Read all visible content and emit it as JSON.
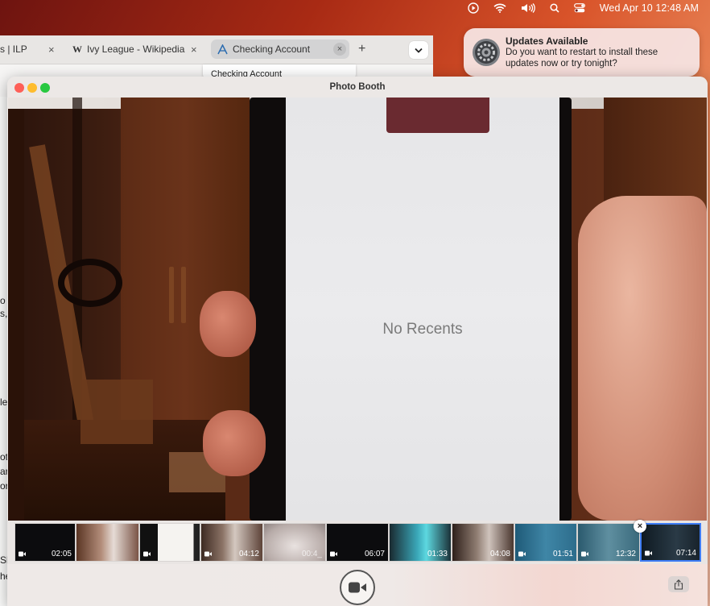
{
  "menubar": {
    "clock": "Wed Apr 10  12:48 AM",
    "icons": [
      "play-circle-icon",
      "wifi-icon",
      "volume-icon",
      "search-icon",
      "control-center-icon"
    ]
  },
  "browser": {
    "tabs": [
      {
        "label": "s | ILP",
        "close": "×"
      },
      {
        "label": "Ivy League - Wikipedia",
        "favicon": "W",
        "close": "×"
      },
      {
        "label": "Checking Account",
        "close": "×",
        "active": true
      }
    ],
    "new_tab": "+",
    "suggestion": "Checking Account",
    "left_fragments": [
      "o",
      "s,",
      "le",
      "ot",
      "ar",
      "or",
      "Sl",
      "he"
    ]
  },
  "notification": {
    "title": "Updates Available",
    "body": "Do you want to restart to install these updates now or try tonight?"
  },
  "photobooth": {
    "title": "Photo Booth",
    "screen_text": "No Recents",
    "thumbnails": [
      {
        "duration": "02:05",
        "video": true
      },
      {
        "duration": "",
        "video": false
      },
      {
        "duration": "",
        "video": true
      },
      {
        "duration": "04:12",
        "video": true
      },
      {
        "duration": "00:4_",
        "video": false
      },
      {
        "duration": "06:07",
        "video": true
      },
      {
        "duration": "01:33",
        "video": false
      },
      {
        "duration": "04:08",
        "video": false
      },
      {
        "duration": "01:51",
        "video": true
      },
      {
        "duration": "12:32",
        "video": true
      },
      {
        "duration": "07:14",
        "video": true,
        "selected": true
      }
    ],
    "delete_label": "×"
  },
  "colors": {
    "accent": "#3d7cf6",
    "traffic_red": "#fe5f57",
    "traffic_yellow": "#febc2e",
    "traffic_green": "#28c840"
  }
}
